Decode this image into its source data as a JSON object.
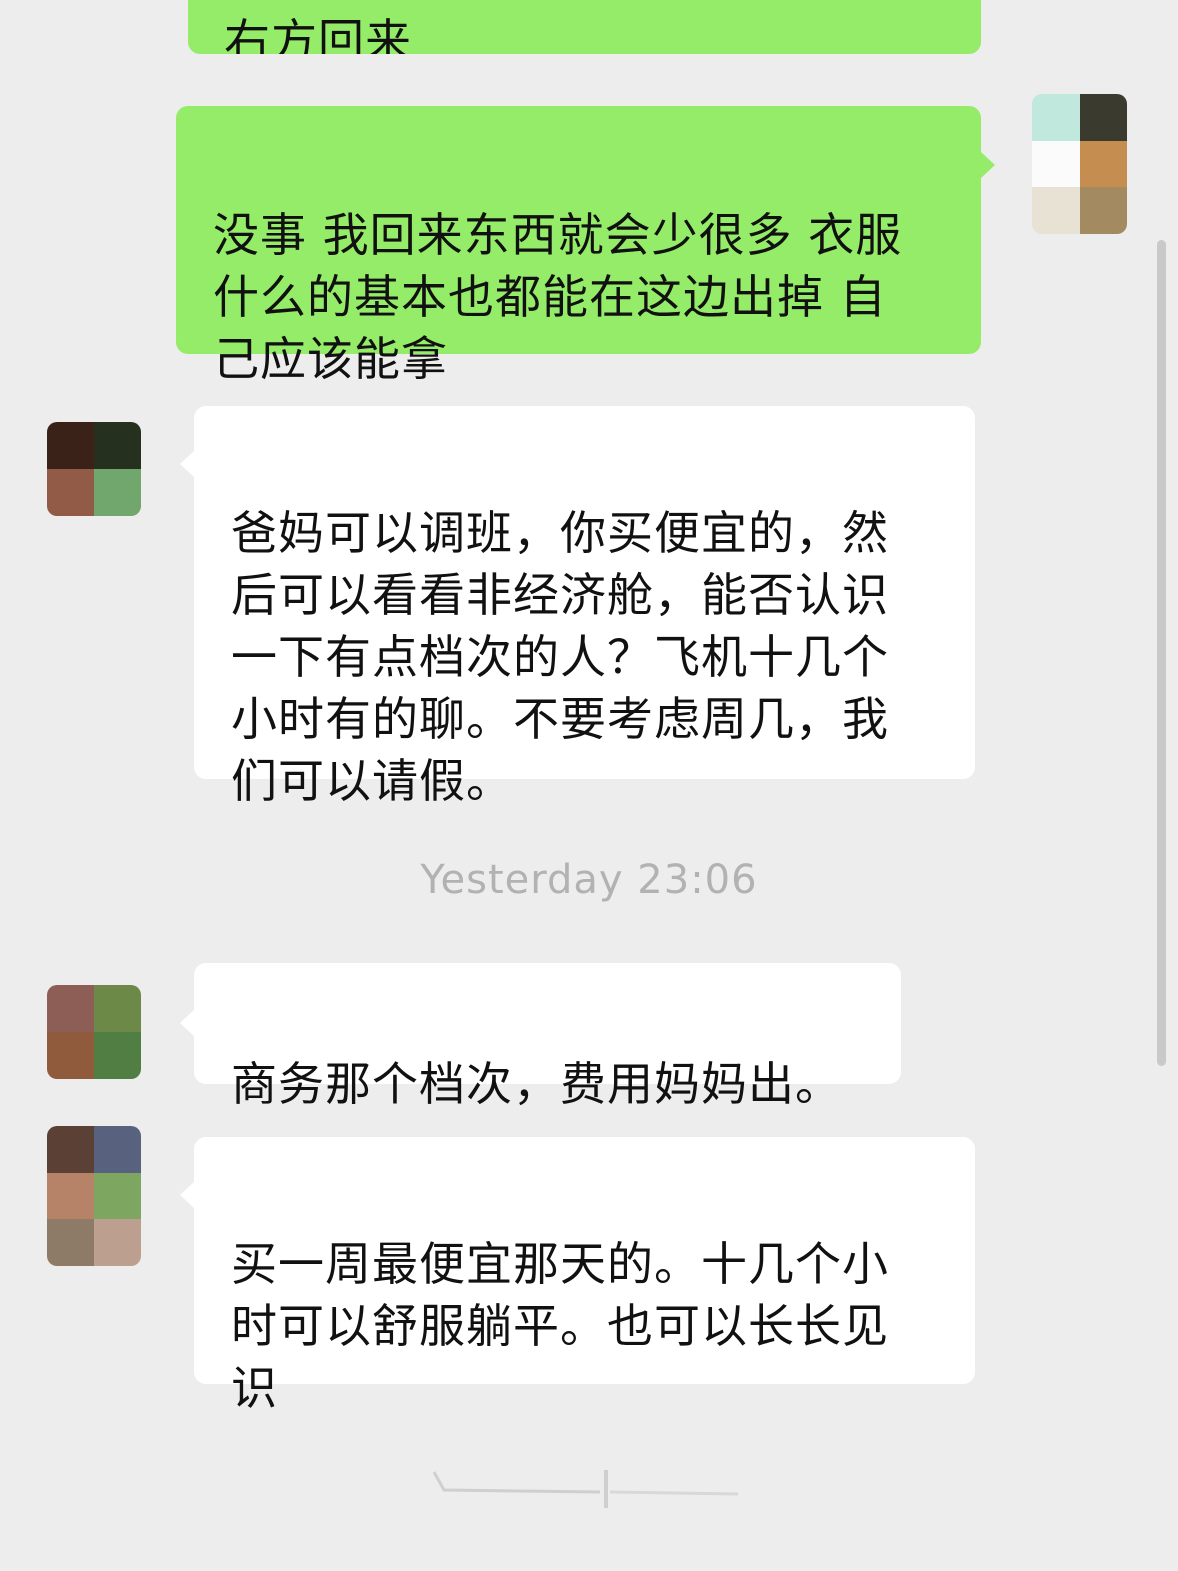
{
  "chat": {
    "messages": [
      {
        "id": "m0",
        "side": "out",
        "text": "右方回来"
      },
      {
        "id": "m1",
        "side": "out",
        "text": "没事 我回来东西就会少很多 衣服\n什么的基本也都能在这边出掉 自\n己应该能拿"
      },
      {
        "id": "m2",
        "side": "in",
        "text": "爸妈可以调班，你买便宜的，然\n后可以看看非经济舱，能否认识\n一下有点档次的人？飞机十几个\n小时有的聊。不要考虑周几，我\n们可以请假。"
      },
      {
        "id": "m3",
        "side": "in",
        "text": "商务那个档次，费用妈妈出。"
      },
      {
        "id": "m4",
        "side": "in",
        "text": "买一周最便宜那天的。十几个小\n时可以舒服躺平。也可以长长见\n识"
      }
    ],
    "timestamp": "Yesterday 23:06"
  },
  "colors": {
    "background": "#ededed",
    "outgoing_bubble": "#95ec69",
    "incoming_bubble": "#ffffff",
    "timestamp_text": "#b2b2b2"
  },
  "avatars": {
    "self": [
      "#bfe8dc",
      "#3a3a2e",
      "#fbfbfb",
      "#c98d4c",
      "#e8e2d4",
      "#a48a5e"
    ],
    "contact_1": [
      "#3c2218",
      "#25301d",
      "#935a45",
      "#6fa86a"
    ],
    "contact_2": [
      "#8e5e55",
      "#6c8a45",
      "#925a3b",
      "#4f7f41"
    ],
    "contact_3": [
      "#5c4035",
      "#57627f",
      "#b88366",
      "#7ba85e",
      "#8e7a66",
      "#bd9f8d"
    ]
  }
}
